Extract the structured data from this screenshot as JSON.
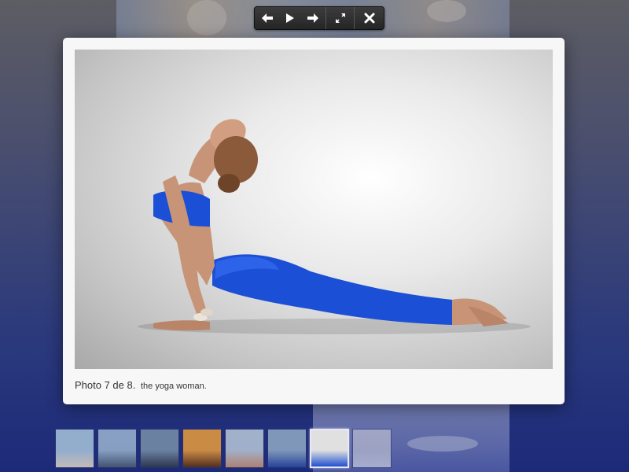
{
  "toolbar": {
    "buttons": [
      {
        "name": "previous-button",
        "icon": "arrow-left-icon"
      },
      {
        "name": "play-button",
        "icon": "play-icon"
      },
      {
        "name": "next-button",
        "icon": "arrow-right-icon"
      },
      {
        "name": "fullscreen-button",
        "icon": "expand-icon"
      },
      {
        "name": "close-button",
        "icon": "close-icon"
      }
    ]
  },
  "caption": {
    "counter": "Photo 7 de 8.",
    "title": "the yoga woman."
  },
  "gallery": {
    "current": 7,
    "total": 8,
    "thumbnails": [
      {
        "index": 1,
        "colors": [
          "#a8c4dc",
          "#e0d4c4"
        ]
      },
      {
        "index": 2,
        "colors": [
          "#9ab4d0",
          "#4a5a70"
        ]
      },
      {
        "index": 3,
        "colors": [
          "#7890a8",
          "#303848"
        ]
      },
      {
        "index": 4,
        "colors": [
          "#e89c3c",
          "#5a3010"
        ]
      },
      {
        "index": 5,
        "colors": [
          "#b8c8d8",
          "#c89070"
        ]
      },
      {
        "index": 6,
        "colors": [
          "#90aac4",
          "#2848a0"
        ]
      },
      {
        "index": 7,
        "colors": [
          "#e0e0e0",
          "#2050d0"
        ]
      },
      {
        "index": 8,
        "colors": [
          "#d4d4dc",
          "#f0f0f0"
        ]
      }
    ]
  },
  "colors": {
    "toolbar_bg": "#2b2b2b",
    "panel_bg": "#f7f7f7",
    "backdrop": "#1c2a7a",
    "outfit_blue": "#1a4fd6"
  }
}
